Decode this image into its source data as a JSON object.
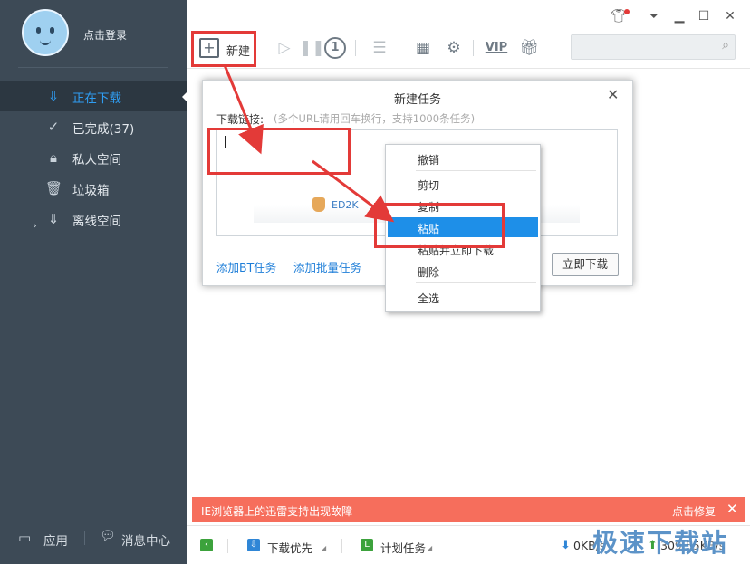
{
  "sidebar": {
    "login_text": "点击登录",
    "items": [
      {
        "label": "正在下载",
        "icon": "download-icon",
        "active": true
      },
      {
        "label": "已完成(37)",
        "icon": "check-circle-icon"
      },
      {
        "label": "私人空间",
        "icon": "lock-icon"
      },
      {
        "label": "垃圾箱",
        "icon": "trash-icon"
      },
      {
        "label": "离线空间",
        "icon": "cloud-download-icon"
      }
    ],
    "bottom": {
      "apps_label": "应用",
      "messages_label": "消息中心"
    }
  },
  "toolbar": {
    "new_label": "新建",
    "icons": [
      "play-icon",
      "pause-icon",
      "speed-limit-icon",
      "settings-list-icon",
      "qr-code-icon",
      "gear-icon",
      "vip-icon",
      "gift-icon"
    ],
    "vip_text": "VIP",
    "one_text": "1",
    "search_placeholder": ""
  },
  "dialog": {
    "title": "新建任务",
    "link_label": "下载链接:",
    "link_hint": "(多个URL请用回车换行，支持1000条任务)",
    "ed2k_label": "ED2K",
    "add_bt_label": "添加BT任务",
    "add_batch_label": "添加批量任务",
    "download_now_label": "立即下载"
  },
  "context_menu": {
    "items": [
      {
        "label": "撤销"
      },
      {
        "label": "剪切"
      },
      {
        "label": "复制"
      },
      {
        "label": "粘贴",
        "selected": true
      },
      {
        "label": "粘贴并立即下载"
      },
      {
        "label": "删除"
      },
      {
        "label": "全选"
      }
    ]
  },
  "banner": {
    "text": "IE浏览器上的迅雷支持出现故障",
    "fix_label": "点击修复",
    "close_glyph": "✕"
  },
  "statusbar": {
    "priority_label": "下载优先",
    "schedule_label": "计划任务",
    "down_speed": "0KB/s",
    "up_speed": "309.55KB/s"
  },
  "watermark": "极速下载站",
  "colors": {
    "sidebar_bg": "#3d4a56",
    "accent_blue": "#2f9df2",
    "annotation_red": "#e33a38",
    "banner_bg": "#f66e5c"
  }
}
